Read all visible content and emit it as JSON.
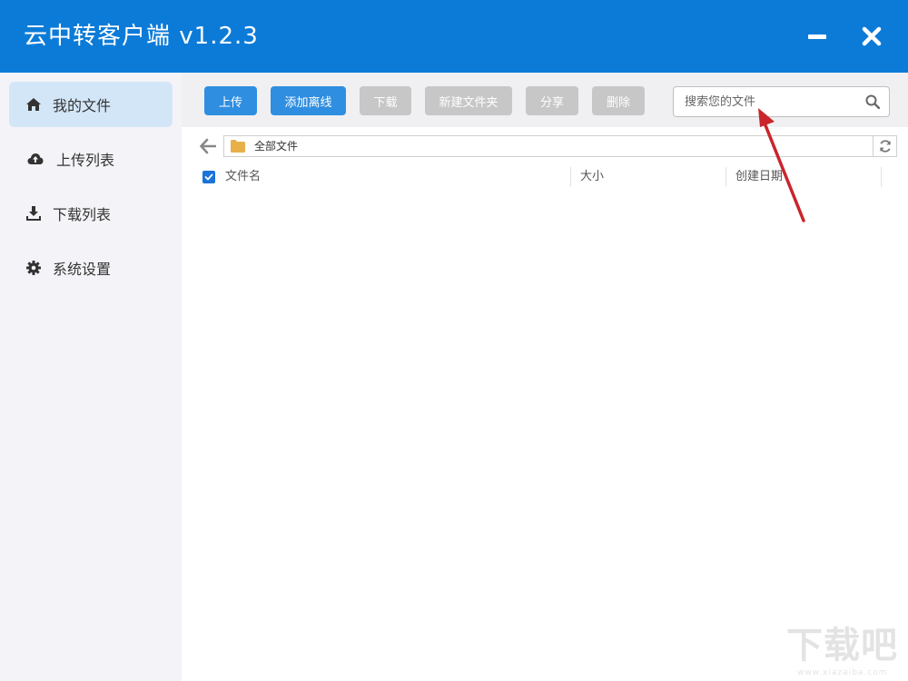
{
  "app": {
    "title": "云中转客户端 v1.2.3",
    "minimize_icon": "minimize-icon",
    "close_icon": "close-icon",
    "accent": "#0c7bd8"
  },
  "sidebar": {
    "items": [
      {
        "label": "我的文件",
        "icon": "home-icon",
        "active": true
      },
      {
        "label": "上传列表",
        "icon": "cloud-upload-icon",
        "active": false
      },
      {
        "label": "下载列表",
        "icon": "download-icon",
        "active": false
      },
      {
        "label": "系统设置",
        "icon": "gear-icon",
        "active": false
      }
    ]
  },
  "toolbar": {
    "upload": "上传",
    "add_offline": "添加离线",
    "download": "下载",
    "new_folder": "新建文件夹",
    "share": "分享",
    "delete": "删除",
    "search_placeholder": "搜索您的文件"
  },
  "path": {
    "current": "全部文件"
  },
  "table": {
    "columns": [
      "文件名",
      "大小",
      "创建日期"
    ],
    "select_all_checked": true
  },
  "watermark": {
    "logo_text": "下载吧",
    "url": "www.xiazaiba.com"
  }
}
